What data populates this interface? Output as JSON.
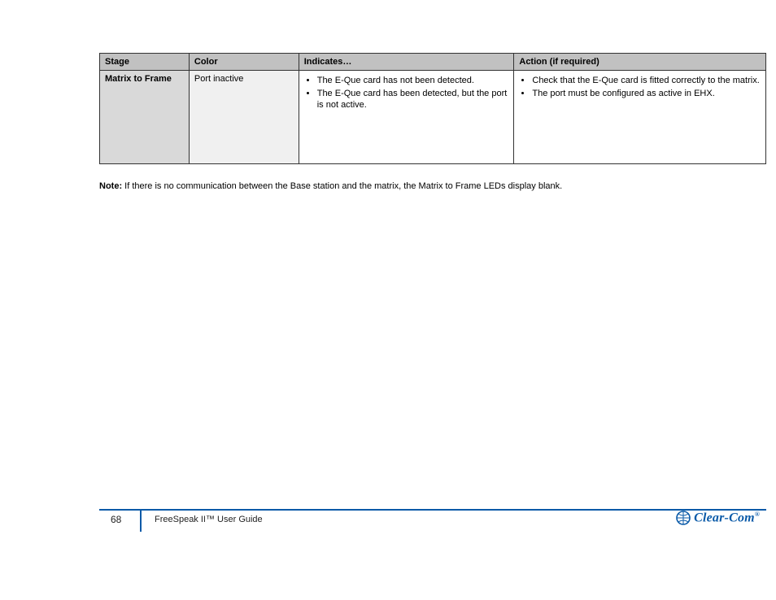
{
  "table": {
    "headers": [
      "Stage",
      "Color",
      "Indicates…",
      "Action (if required)"
    ],
    "row": {
      "stage": "Matrix to Frame",
      "color": "Port inactive",
      "indicates": [
        "The E-Que card has not been detected.",
        "The E-Que card has been detected, but the port is not active."
      ],
      "action": [
        "Check that the E-Que card is fitted correctly to the matrix.",
        "The port must be configured as active in EHX."
      ]
    }
  },
  "note": {
    "label": "Note:",
    "body": " If there is no communication between the Base station and the matrix, the Matrix to Frame LEDs display blank."
  },
  "footer": {
    "page": "68",
    "line1": "FreeSpeak II™ User Guide",
    "line2": ""
  },
  "logo": {
    "text": "Clear-Com",
    "mark_name": "globe-icon"
  }
}
